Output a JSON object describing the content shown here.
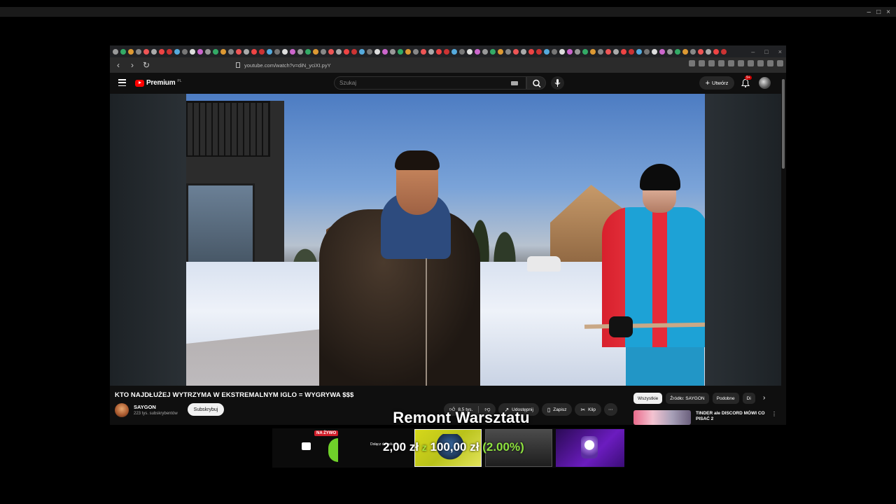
{
  "window": {
    "controls": [
      "–",
      "□",
      "×"
    ]
  },
  "browser": {
    "url": "youtube.com/watch?v=diN_yciXI.pyY",
    "nav": {
      "back": "‹",
      "forward": "›",
      "reload": "↻"
    }
  },
  "youtube": {
    "brand": "Premium",
    "brand_sup": "PL",
    "search_placeholder": "Szukaj",
    "create_label": "Utwórz",
    "notif_count": "9+",
    "video": {
      "title": "KTO NAJDŁUŻEJ WYTRZYMA W EKSTREMALNYM IGLO = WYGRYWA $$$",
      "channel": "SAYGON",
      "subscribers": "223 tys. subskrybentów",
      "subscribe_label": "Subskrybuj",
      "likes": "8,5 tys.",
      "share_label": "Udostępnij",
      "save_label": "Zapisz",
      "clip_label": "Klip",
      "more_label": "⋯"
    },
    "chips": [
      "Wszystkie",
      "Źródło: SAYGON",
      "Podobne",
      "Di"
    ],
    "recommendation": {
      "title": "TINDER ale DISCORD MÓWI CO PISAĆ 2"
    }
  },
  "stream_overlay": {
    "title": "Remont Warsztatu",
    "live_badge": "NA ŻYWO",
    "goal_current": "2,00 zł",
    "goal_sep": "z",
    "goal_target": "100,00 zł",
    "goal_percent": "(2.00%)",
    "goal_fraction": 0.02,
    "donate_small": "Dołącz\ndo celu"
  },
  "colors": {
    "yt_red": "#ff0000",
    "goal_green": "#8ee23f",
    "live_red": "#d11f2b"
  }
}
